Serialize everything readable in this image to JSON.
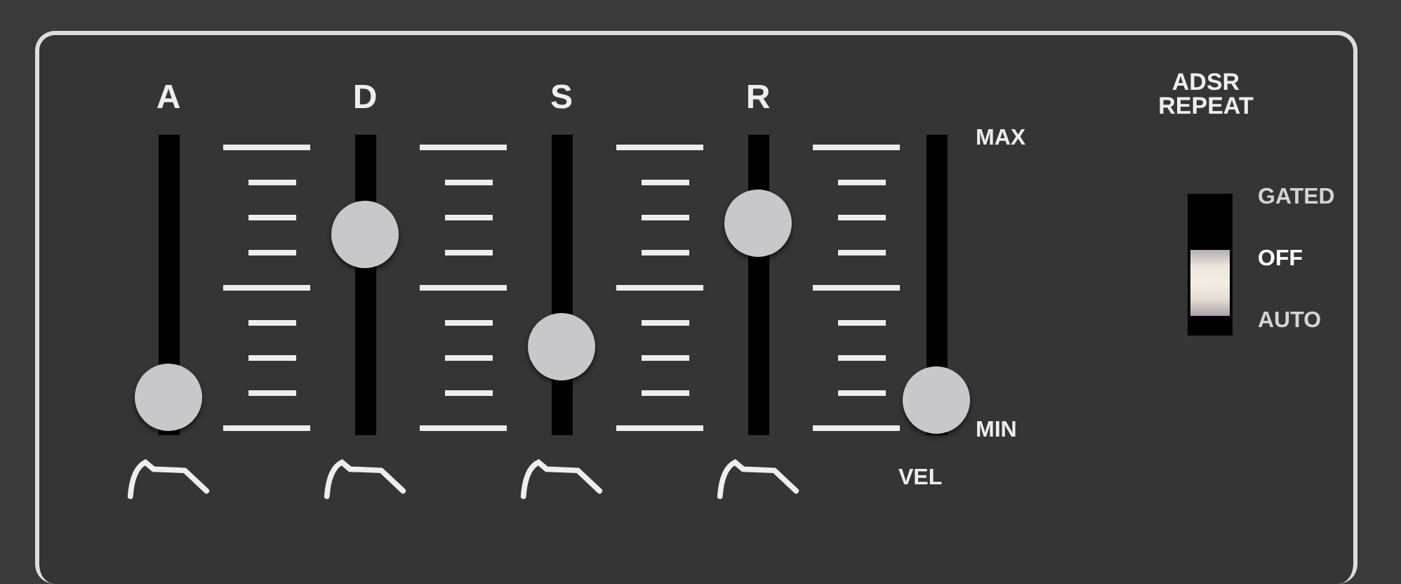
{
  "sliders": [
    {
      "label": "A",
      "level": 0.01
    },
    {
      "label": "D",
      "level": 0.72
    },
    {
      "label": "S",
      "level": 0.23
    },
    {
      "label": "R",
      "level": 0.77
    }
  ],
  "velocity": {
    "label": "VEL",
    "max_label": "MAX",
    "min_label": "MIN",
    "level": 0.0
  },
  "repeat_switch": {
    "title": "ADSR REPEAT",
    "options": [
      {
        "label": "GATED",
        "selected": false
      },
      {
        "label": "OFF",
        "selected": true
      },
      {
        "label": "AUTO",
        "selected": false
      }
    ]
  }
}
